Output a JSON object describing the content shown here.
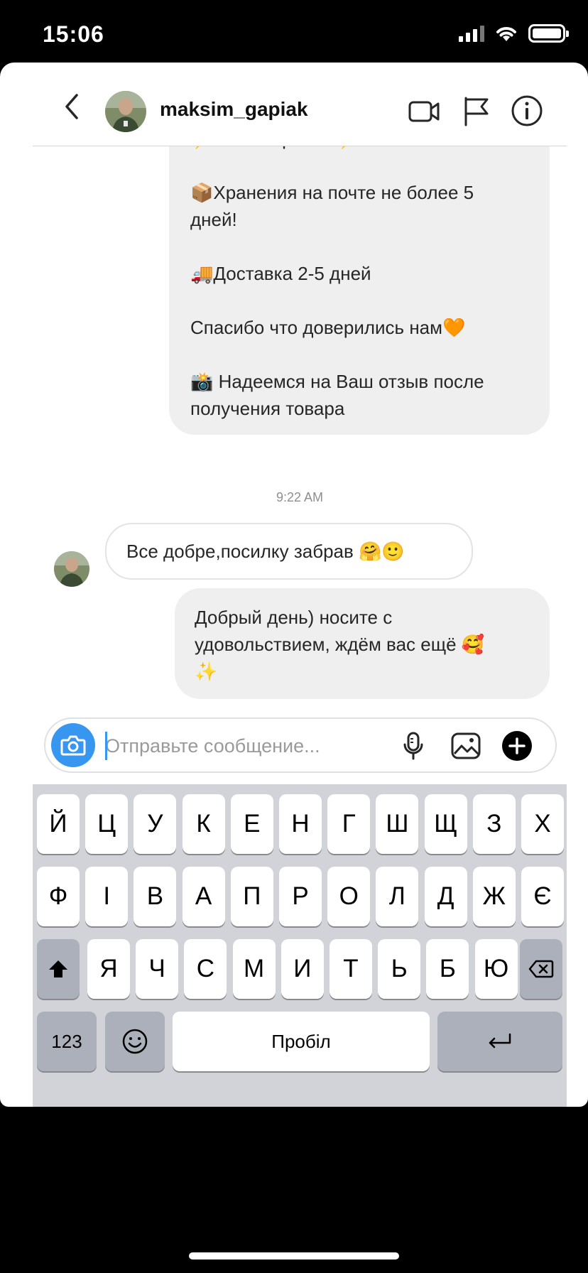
{
  "status_bar": {
    "time": "15:06"
  },
  "header": {
    "username": "maksim_gapiak"
  },
  "messages": {
    "outgoing_1": "⚡️ Заказ принят ⚡️\n\n📦Хранения на почте не более 5\nдней!\n\n🚚Доставка 2-5 дней\n\nСпасибо что доверились нам🧡\n\n📸 Надеемся на Ваш отзыв после\nполучения товара",
    "timestamp": "9:22 AM",
    "incoming_1": "Все добре,посилку забрав 🤗🙂",
    "outgoing_2": "Добрый день) носите с\nудовольствием, ждём вас ещё 🥰\n✨"
  },
  "composer": {
    "placeholder": "Отправьте сообщение..."
  },
  "keyboard": {
    "row1": [
      "Й",
      "Ц",
      "У",
      "К",
      "Е",
      "Н",
      "Г",
      "Ш",
      "Щ",
      "З",
      "Х"
    ],
    "row2": [
      "Ф",
      "І",
      "В",
      "А",
      "П",
      "Р",
      "О",
      "Л",
      "Д",
      "Ж",
      "Є"
    ],
    "row3": [
      "Я",
      "Ч",
      "С",
      "М",
      "И",
      "Т",
      "Ь",
      "Б",
      "Ю"
    ],
    "numbers_label": "123",
    "space_label": "Пробіл"
  },
  "colors": {
    "accent": "#3797f0",
    "outgoing_bubble": "#efefef",
    "keyboard_bg": "#d1d3d9"
  },
  "icons": {
    "back": "chevron-left-icon",
    "video": "video-camera-icon",
    "report": "flag-icon",
    "info": "info-icon",
    "camera": "camera-icon",
    "mic": "microphone-icon",
    "gallery": "image-icon",
    "more": "plus-circle-icon",
    "shift": "shift-icon",
    "delete": "backspace-icon",
    "emoji": "emoji-icon",
    "return": "return-icon"
  }
}
